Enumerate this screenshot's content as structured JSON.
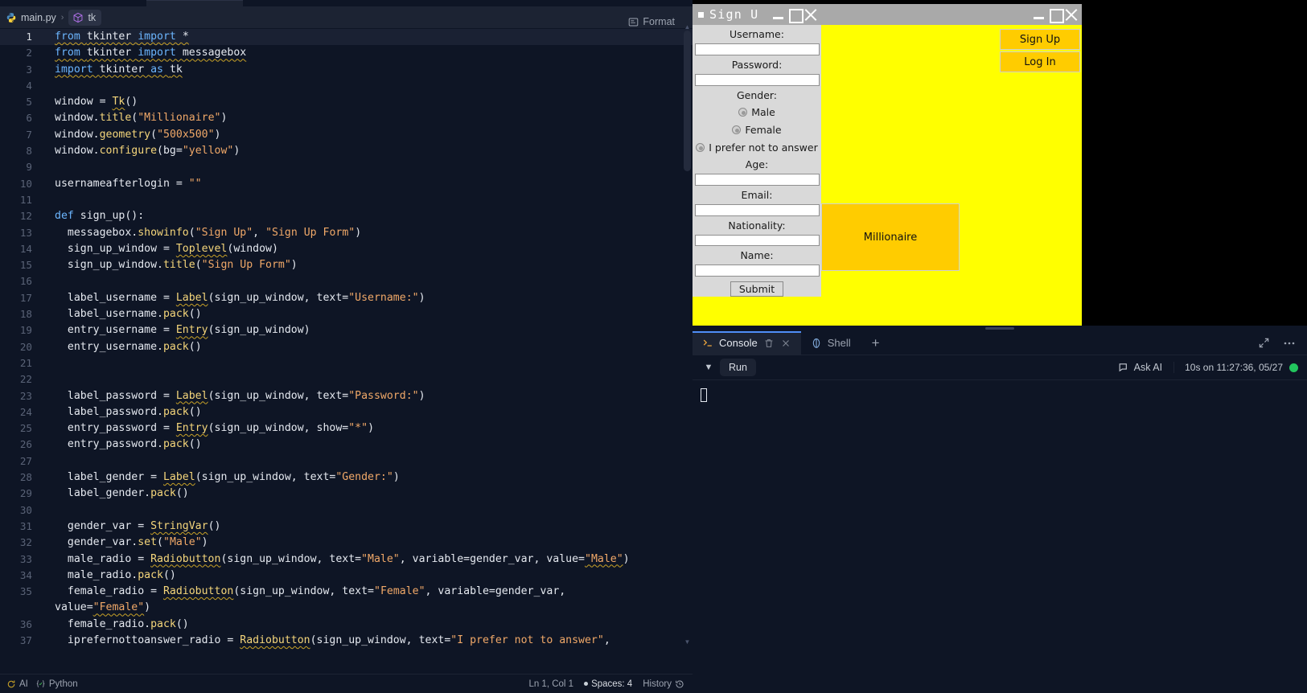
{
  "editor": {
    "breadcrumb": {
      "file": "main.py",
      "separator": "›",
      "symbol": "tk"
    },
    "format_label": "Format",
    "lines": [
      {
        "n": "1",
        "highlight": true,
        "tokens": [
          {
            "t": "from ",
            "c": "kw",
            "squig": true
          },
          {
            "t": "tkinter ",
            "c": "plain",
            "squig": true
          },
          {
            "t": "import ",
            "c": "kw",
            "squig": true
          },
          {
            "t": "*",
            "c": "plain",
            "squig": true
          }
        ]
      },
      {
        "n": "2",
        "highlight": false,
        "tokens": [
          {
            "t": "from ",
            "c": "kw",
            "squig": true
          },
          {
            "t": "tkinter ",
            "c": "plain",
            "squig": true
          },
          {
            "t": "import ",
            "c": "kw",
            "squig": true
          },
          {
            "t": "messagebox",
            "c": "plain",
            "squig": true
          }
        ]
      },
      {
        "n": "3",
        "highlight": false,
        "tokens": [
          {
            "t": "import ",
            "c": "kw",
            "squig": true
          },
          {
            "t": "tkinter ",
            "c": "plain",
            "squig": true
          },
          {
            "t": "as ",
            "c": "kw",
            "squig": true
          },
          {
            "t": "tk",
            "c": "plain",
            "squig": true
          }
        ]
      },
      {
        "n": "4",
        "highlight": false,
        "tokens": []
      },
      {
        "n": "5",
        "highlight": false,
        "tokens": [
          {
            "t": "window = ",
            "c": "plain"
          },
          {
            "t": "Tk",
            "c": "cls",
            "squig": true
          },
          {
            "t": "()",
            "c": "plain"
          }
        ]
      },
      {
        "n": "6",
        "highlight": false,
        "tokens": [
          {
            "t": "window.",
            "c": "plain"
          },
          {
            "t": "title",
            "c": "fn"
          },
          {
            "t": "(",
            "c": "plain"
          },
          {
            "t": "\"Millionaire\"",
            "c": "str"
          },
          {
            "t": ")",
            "c": "plain"
          }
        ]
      },
      {
        "n": "7",
        "highlight": false,
        "tokens": [
          {
            "t": "window.",
            "c": "plain"
          },
          {
            "t": "geometry",
            "c": "fn"
          },
          {
            "t": "(",
            "c": "plain"
          },
          {
            "t": "\"500x500\"",
            "c": "str"
          },
          {
            "t": ")",
            "c": "plain"
          }
        ]
      },
      {
        "n": "8",
        "highlight": false,
        "tokens": [
          {
            "t": "window.",
            "c": "plain"
          },
          {
            "t": "configure",
            "c": "fn"
          },
          {
            "t": "(bg=",
            "c": "plain"
          },
          {
            "t": "\"yellow\"",
            "c": "str"
          },
          {
            "t": ")",
            "c": "plain"
          }
        ]
      },
      {
        "n": "9",
        "highlight": false,
        "tokens": []
      },
      {
        "n": "10",
        "highlight": false,
        "tokens": [
          {
            "t": "usernameafterlogin = ",
            "c": "plain"
          },
          {
            "t": "\"\"",
            "c": "str"
          }
        ]
      },
      {
        "n": "11",
        "highlight": false,
        "tokens": []
      },
      {
        "n": "12",
        "highlight": false,
        "tokens": [
          {
            "t": "def ",
            "c": "kw"
          },
          {
            "t": "sign_up",
            "c": "plain"
          },
          {
            "t": "():",
            "c": "plain"
          }
        ]
      },
      {
        "n": "13",
        "highlight": false,
        "tokens": [
          {
            "t": "  messagebox.",
            "c": "plain"
          },
          {
            "t": "showinfo",
            "c": "fn"
          },
          {
            "t": "(",
            "c": "plain"
          },
          {
            "t": "\"Sign Up\"",
            "c": "str"
          },
          {
            "t": ", ",
            "c": "plain"
          },
          {
            "t": "\"Sign Up Form\"",
            "c": "str"
          },
          {
            "t": ")",
            "c": "plain"
          }
        ]
      },
      {
        "n": "14",
        "highlight": false,
        "tokens": [
          {
            "t": "  sign_up_window = ",
            "c": "plain"
          },
          {
            "t": "Toplevel",
            "c": "cls",
            "squig": true
          },
          {
            "t": "(window)",
            "c": "plain"
          }
        ]
      },
      {
        "n": "15",
        "highlight": false,
        "tokens": [
          {
            "t": "  sign_up_window.",
            "c": "plain"
          },
          {
            "t": "title",
            "c": "fn"
          },
          {
            "t": "(",
            "c": "plain"
          },
          {
            "t": "\"Sign Up Form\"",
            "c": "str"
          },
          {
            "t": ")",
            "c": "plain"
          }
        ]
      },
      {
        "n": "16",
        "highlight": false,
        "tokens": []
      },
      {
        "n": "17",
        "highlight": false,
        "tokens": [
          {
            "t": "  label_username = ",
            "c": "plain"
          },
          {
            "t": "Label",
            "c": "cls",
            "squig": true
          },
          {
            "t": "(sign_up_window, text=",
            "c": "plain"
          },
          {
            "t": "\"Username:\"",
            "c": "str"
          },
          {
            "t": ")",
            "c": "plain"
          }
        ]
      },
      {
        "n": "18",
        "highlight": false,
        "tokens": [
          {
            "t": "  label_username.",
            "c": "plain"
          },
          {
            "t": "pack",
            "c": "fn"
          },
          {
            "t": "()",
            "c": "plain"
          }
        ]
      },
      {
        "n": "19",
        "highlight": false,
        "tokens": [
          {
            "t": "  entry_username = ",
            "c": "plain"
          },
          {
            "t": "Entry",
            "c": "cls",
            "squig": true
          },
          {
            "t": "(sign_up_window)",
            "c": "plain"
          }
        ]
      },
      {
        "n": "20",
        "highlight": false,
        "tokens": [
          {
            "t": "  entry_username.",
            "c": "plain"
          },
          {
            "t": "pack",
            "c": "fn"
          },
          {
            "t": "()",
            "c": "plain"
          }
        ]
      },
      {
        "n": "21",
        "highlight": false,
        "tokens": []
      },
      {
        "n": "22",
        "highlight": false,
        "tokens": []
      },
      {
        "n": "23",
        "highlight": false,
        "tokens": [
          {
            "t": "  label_password = ",
            "c": "plain"
          },
          {
            "t": "Label",
            "c": "cls",
            "squig": true
          },
          {
            "t": "(sign_up_window, text=",
            "c": "plain"
          },
          {
            "t": "\"Password:\"",
            "c": "str"
          },
          {
            "t": ")",
            "c": "plain"
          }
        ]
      },
      {
        "n": "24",
        "highlight": false,
        "tokens": [
          {
            "t": "  label_password.",
            "c": "plain"
          },
          {
            "t": "pack",
            "c": "fn"
          },
          {
            "t": "()",
            "c": "plain"
          }
        ]
      },
      {
        "n": "25",
        "highlight": false,
        "tokens": [
          {
            "t": "  entry_password = ",
            "c": "plain"
          },
          {
            "t": "Entry",
            "c": "cls",
            "squig": true
          },
          {
            "t": "(sign_up_window, show=",
            "c": "plain"
          },
          {
            "t": "\"*\"",
            "c": "str"
          },
          {
            "t": ")",
            "c": "plain"
          }
        ]
      },
      {
        "n": "26",
        "highlight": false,
        "tokens": [
          {
            "t": "  entry_password.",
            "c": "plain"
          },
          {
            "t": "pack",
            "c": "fn"
          },
          {
            "t": "()",
            "c": "plain"
          }
        ]
      },
      {
        "n": "27",
        "highlight": false,
        "tokens": []
      },
      {
        "n": "28",
        "highlight": false,
        "tokens": [
          {
            "t": "  label_gender = ",
            "c": "plain"
          },
          {
            "t": "Label",
            "c": "cls",
            "squig": true
          },
          {
            "t": "(sign_up_window, text=",
            "c": "plain"
          },
          {
            "t": "\"Gender:\"",
            "c": "str"
          },
          {
            "t": ")",
            "c": "plain"
          }
        ]
      },
      {
        "n": "29",
        "highlight": false,
        "tokens": [
          {
            "t": "  label_gender.",
            "c": "plain"
          },
          {
            "t": "pack",
            "c": "fn"
          },
          {
            "t": "()",
            "c": "plain"
          }
        ]
      },
      {
        "n": "30",
        "highlight": false,
        "tokens": []
      },
      {
        "n": "31",
        "highlight": false,
        "tokens": [
          {
            "t": "  gender_var = ",
            "c": "plain"
          },
          {
            "t": "StringVar",
            "c": "cls",
            "squig": true
          },
          {
            "t": "()",
            "c": "plain"
          }
        ]
      },
      {
        "n": "32",
        "highlight": false,
        "tokens": [
          {
            "t": "  gender_var.",
            "c": "plain"
          },
          {
            "t": "set",
            "c": "fn"
          },
          {
            "t": "(",
            "c": "plain"
          },
          {
            "t": "\"Male\"",
            "c": "str"
          },
          {
            "t": ")",
            "c": "plain"
          }
        ]
      },
      {
        "n": "33",
        "highlight": false,
        "tokens": [
          {
            "t": "  male_radio = ",
            "c": "plain"
          },
          {
            "t": "Radiobutton",
            "c": "cls",
            "squig": true
          },
          {
            "t": "(sign_up_window, text=",
            "c": "plain"
          },
          {
            "t": "\"Male\"",
            "c": "str"
          },
          {
            "t": ", variable=gender_var, value=",
            "c": "plain"
          },
          {
            "t": "\"Male\"",
            "c": "str",
            "squig": true
          },
          {
            "t": ")",
            "c": "plain"
          }
        ]
      },
      {
        "n": "34",
        "highlight": false,
        "tokens": [
          {
            "t": "  male_radio.",
            "c": "plain"
          },
          {
            "t": "pack",
            "c": "fn"
          },
          {
            "t": "()",
            "c": "plain"
          }
        ]
      },
      {
        "n": "35",
        "highlight": false,
        "tokens": [
          {
            "t": "  female_radio = ",
            "c": "plain"
          },
          {
            "t": "Radiobutton",
            "c": "cls",
            "squig": true
          },
          {
            "t": "(sign_up_window, text=",
            "c": "plain"
          },
          {
            "t": "\"Female\"",
            "c": "str"
          },
          {
            "t": ", variable=gender_var,",
            "c": "plain"
          }
        ],
        "wrap": [
          {
            "t": "value=",
            "c": "plain"
          },
          {
            "t": "\"Female\"",
            "c": "str",
            "squig": true
          },
          {
            "t": ")",
            "c": "plain"
          }
        ]
      },
      {
        "n": "36",
        "highlight": false,
        "tokens": [
          {
            "t": "  female_radio.",
            "c": "plain"
          },
          {
            "t": "pack",
            "c": "fn"
          },
          {
            "t": "()",
            "c": "plain"
          }
        ]
      },
      {
        "n": "37",
        "highlight": false,
        "tokens": [
          {
            "t": "  iprefernottoanswer_radio = ",
            "c": "plain"
          },
          {
            "t": "Radiobutton",
            "c": "cls",
            "squig": true
          },
          {
            "t": "(sign_up_window, text=",
            "c": "plain"
          },
          {
            "t": "\"I prefer not to answer\"",
            "c": "str"
          },
          {
            "t": ",",
            "c": "plain"
          }
        ]
      }
    ],
    "statusbar": {
      "ai_label": "AI",
      "language": "Python",
      "cursor": "Ln 1, Col 1",
      "spaces": "Spaces: 4",
      "history": "History"
    }
  },
  "preview": {
    "main_window": {
      "title": "",
      "bg_color": "#ffff00",
      "buttons": [
        {
          "label": "Sign Up"
        },
        {
          "label": "Log In"
        }
      ],
      "millionaire_label": "Millionaire",
      "accent_color": "#ffcc00"
    },
    "signup_window": {
      "title": "Sign U",
      "fields": [
        {
          "label": "Username:",
          "value": ""
        },
        {
          "label": "Password:",
          "value": ""
        }
      ],
      "gender_label": "Gender:",
      "gender_options": [
        "Male",
        "Female",
        "I prefer not to answer"
      ],
      "fields2": [
        {
          "label": "Age:",
          "value": ""
        },
        {
          "label": "Email:",
          "value": ""
        },
        {
          "label": "Nationality:",
          "value": ""
        },
        {
          "label": "Name:",
          "value": ""
        }
      ],
      "submit_label": "Submit"
    }
  },
  "console": {
    "tabs": [
      {
        "label": "Console",
        "active": true
      },
      {
        "label": "Shell",
        "active": false
      }
    ],
    "add_tab": "+",
    "run_label": "Run",
    "ask_ai_label": "Ask AI",
    "run_meta": "10s on 11:27:36, 05/27",
    "status_color": "#22c55e",
    "output": ""
  }
}
